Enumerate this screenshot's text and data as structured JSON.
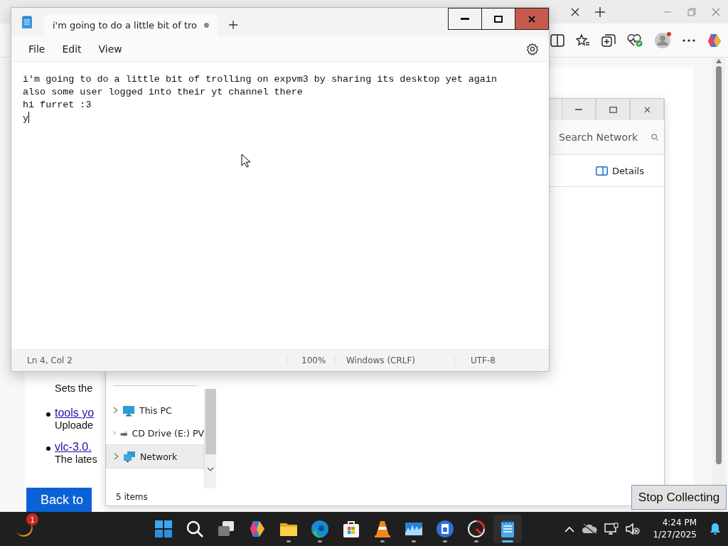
{
  "browser": {
    "page": {
      "intro": "Sets the",
      "items": [
        {
          "link": "tools yo",
          "description": "Uploade"
        },
        {
          "link": "vlc-3.0.",
          "description": "The lates"
        }
      ],
      "button": "Back to"
    }
  },
  "explorer": {
    "search": {
      "placeholder": "Search Network"
    },
    "details_button": "Details",
    "nav_items": [
      {
        "kind": "computer",
        "label": "This PC",
        "selected": false
      },
      {
        "kind": "drive",
        "label": "CD Drive (E:) PV",
        "selected": false
      },
      {
        "kind": "network",
        "label": "Network",
        "selected": true
      }
    ],
    "status": "5 items"
  },
  "notepad": {
    "tab": {
      "title": "i'm going to do a little bit of tro",
      "modified": true
    },
    "menu": [
      "File",
      "Edit",
      "View"
    ],
    "lines": [
      "i'm going to do a little bit of trolling on expvm3 by sharing its desktop yet again",
      "also some user logged into their yt channel there",
      "hi furret :3",
      "y"
    ],
    "status": [
      "Ln 4, Col 2",
      "100%",
      "Windows (CRLF)",
      "UTF-8"
    ]
  },
  "stop_button": "Stop Collecting",
  "taskbar": {
    "widgets_badge": "1",
    "apps": [
      {
        "kind": "start",
        "running": false,
        "active": false
      },
      {
        "kind": "search",
        "running": false,
        "active": false
      },
      {
        "kind": "taskview",
        "running": false,
        "active": false
      },
      {
        "kind": "copilot",
        "running": false,
        "active": false
      },
      {
        "kind": "explorer",
        "running": true,
        "active": false
      },
      {
        "kind": "edge",
        "running": true,
        "active": false
      },
      {
        "kind": "store",
        "running": false,
        "active": false
      },
      {
        "kind": "vlc",
        "running": true,
        "active": false
      },
      {
        "kind": "photos",
        "running": true,
        "active": false
      },
      {
        "kind": "disk",
        "running": true,
        "active": false
      },
      {
        "kind": "gauge",
        "running": true,
        "active": false
      },
      {
        "kind": "notepad",
        "running": true,
        "active": true
      }
    ],
    "time": "4:24 PM",
    "date": "1/27/2025"
  }
}
